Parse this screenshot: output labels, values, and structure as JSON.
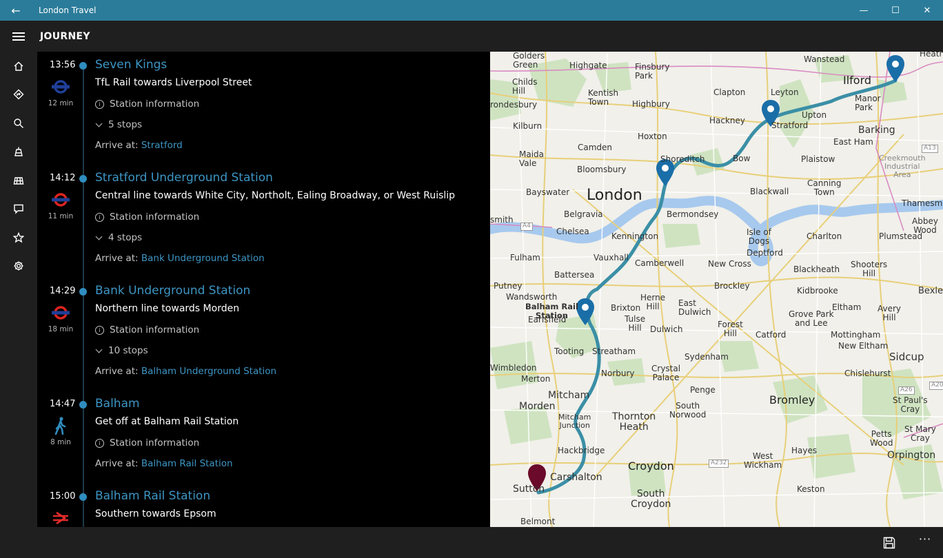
{
  "window": {
    "title": "London Travel",
    "minimize": "—",
    "maximize": "☐",
    "close": "✕",
    "back": "←"
  },
  "header": {
    "title": "JOURNEY"
  },
  "nav": [
    "home-icon",
    "directions-icon",
    "search-icon",
    "cable-car-icon",
    "map-grid-icon",
    "feedback-icon",
    "star-icon",
    "settings-icon"
  ],
  "legs": [
    {
      "time": "13:56",
      "station": "Seven Kings",
      "line": "TfL Rail towards Liverpool Street",
      "mode": "tfl-rail",
      "duration": "12 min",
      "info": "Station information",
      "stops": "5 stops",
      "arrive_label": "Arrive at:",
      "arrive_station": "Stratford"
    },
    {
      "time": "14:12",
      "station": "Stratford Underground Station",
      "line": "Central line towards White City, Northolt, Ealing Broadway, or West Ruislip",
      "mode": "underground",
      "duration": "11 min",
      "info": "Station information",
      "stops": "4 stops",
      "arrive_label": "Arrive at:",
      "arrive_station": "Bank Underground Station"
    },
    {
      "time": "14:29",
      "station": "Bank Underground Station",
      "line": "Northern line towards Morden",
      "mode": "underground",
      "duration": "18 min",
      "info": "Station information",
      "stops": "10 stops",
      "arrive_label": "Arrive at:",
      "arrive_station": "Balham Underground Station"
    },
    {
      "time": "14:47",
      "station": "Balham",
      "line": "Get off at Balham Rail Station",
      "mode": "walk",
      "duration": "8 min",
      "info": "Station information",
      "stops": "",
      "arrive_label": "Arrive at:",
      "arrive_station": "Balham Rail Station"
    },
    {
      "time": "15:00",
      "station": "Balham Rail Station",
      "line": "Southern towards Epsom",
      "mode": "national-rail",
      "duration": "",
      "info": "",
      "stops": "",
      "arrive_label": "",
      "arrive_station": ""
    }
  ],
  "map": {
    "labels": {
      "golders_green": "Golders\nGreen",
      "highgate": "Highgate",
      "finsbury_park": "Finsbury\nPark",
      "wanstead": "Wanstead",
      "heath": "Heath",
      "childs_hill": "Childs\nHill",
      "kentish_town": "Kentish\nTown",
      "highbury": "Highbury",
      "clapton": "Clapton",
      "leyton": "Leyton",
      "ilford": "Ilford",
      "manor_park": "Manor\nPark",
      "hackney": "Hackney",
      "stratford": "Stratford",
      "upton": "Upton",
      "barking": "Barking",
      "rondesbury": "rondesbury",
      "kilburn": "Kilburn",
      "hoxton": "Hoxton",
      "east_ham": "East Ham",
      "camden": "Camden",
      "shoreditch": "Shoreditch",
      "bow": "Bow",
      "plaistow": "Plaistow",
      "maida_vale": "Maida\nVale",
      "bloomsbury": "Bloomsbury",
      "creekmouth": "Creekmouth\nIndustrial\nArea",
      "canning_town": "Canning\nTown",
      "bayswater": "Bayswater",
      "london": "London",
      "blackwall": "Blackwall",
      "thamesmead": "Thamesme",
      "smith": "smith",
      "belgravia": "Belgravia",
      "bermondsey": "Bermondsey",
      "abbey_wood": "Abbey\nWood",
      "chelsea": "Chelsea",
      "isle_of_dogs": "Isle of\nDogs",
      "charlton": "Charlton",
      "plumstead": "Plumstead",
      "kennington": "Kennington",
      "deptford": "Deptford",
      "fulham": "Fulham",
      "vauxhall": "Vauxhall",
      "camberwell": "Camberwell",
      "new_cross": "New Cross",
      "shooters_hill": "Shooters\nHill",
      "battersea": "Battersea",
      "blackheath": "Blackheath",
      "putney": "Putney",
      "brockley": "Brockley",
      "wandsworth": "Wandsworth",
      "kidbrooke": "Kidbrooke",
      "bexley": "Bexle",
      "balham_rail": "Balham Rail\nStation",
      "brixton": "Brixton",
      "herne_hill": "Herne\nHill",
      "east_dulwich": "East\nDulwich",
      "eltham": "Eltham",
      "avery_hill": "Avery\nHill",
      "earlsfield": "Earlsfield",
      "tulse_hill": "Tulse\nHill",
      "dulwich": "Dulwich",
      "forest_hill": "Forest\nHill",
      "grove_park": "Grove Park\nand Lee",
      "catford": "Catford",
      "mottingham": "Mottingham",
      "new_eltham": "New Eltham",
      "tooting": "Tooting",
      "streatham": "Streatham",
      "sydenham": "Sydenham",
      "sidcup": "Sidcup",
      "wimbledon": "Wimbledon",
      "norbury": "Norbury",
      "crystal_palace": "Crystal\nPalace",
      "chislehurst": "Chislehurst",
      "merton": "Merton",
      "penge": "Penge",
      "mitcham": "Mitcham",
      "bromley": "Bromley",
      "morden": "Morden",
      "south_norwood": "South\nNorwood",
      "st_pauls_cray": "St Paul's\nCray",
      "mitcham_junction": "Mitcham\nJunction",
      "thornton_heath": "Thornton\nHeath",
      "petts_wood": "Petts\nWood",
      "st_mary_cray": "St Mary\nCray",
      "hackbridge": "Hackbridge",
      "hayes": "Hayes",
      "orpington": "Orpington",
      "croydon": "Croydon",
      "west_wickham": "West\nWickham",
      "carshalton": "Carshalton",
      "sutton": "Sutton",
      "keston": "Keston",
      "south_croydon": "South\nCroydon",
      "belmont": "Belmont",
      "a13": "A13",
      "a4": "A4",
      "a232": "A232",
      "a20": "A20",
      "a26": "A26"
    }
  },
  "bottom": {
    "more": "···"
  },
  "colors": {
    "accent": "#2b7c9a",
    "link": "#3d95c3",
    "route": "#3b8fa6",
    "pin_blue": "#1a6ea8",
    "pin_end": "#6b0a2a"
  }
}
